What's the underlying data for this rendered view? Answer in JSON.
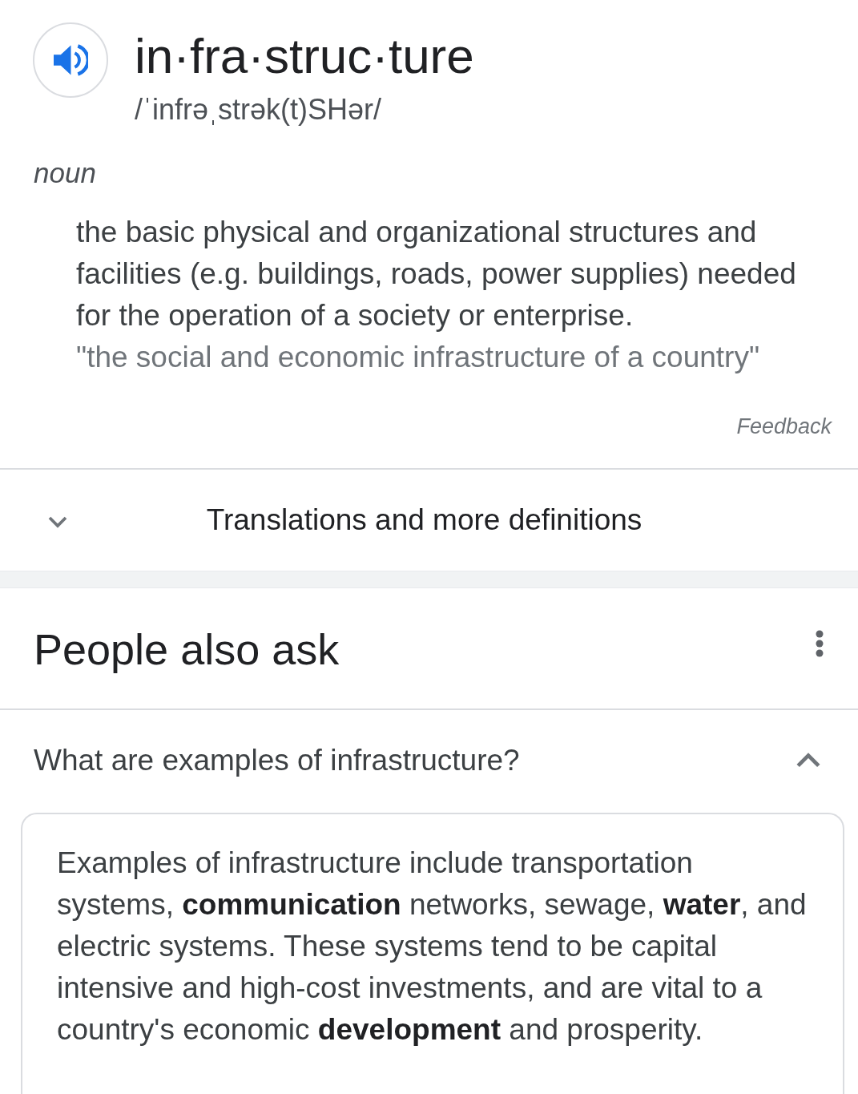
{
  "entry": {
    "headword": "in·fra·struc·ture",
    "pronunciation": "/ˈinfrəˌstrək(t)SHər/",
    "part_of_speech": "noun",
    "definition": "the basic physical and organizational structures and facilities (e.g. buildings, roads, power supplies) needed for the operation of a society or enterprise.",
    "example": "\"the social and economic infrastructure of a country\"",
    "feedback": "Feedback"
  },
  "translations": {
    "label": "Translations and more definitions",
    "expanded": false
  },
  "people_also_ask": {
    "title": "People also ask",
    "questions": [
      {
        "question": "What are examples of infrastructure?",
        "expanded": true,
        "answer": "Examples of infrastructure include transportation systems, **communication** networks, sewage, **water**, and electric systems. These systems tend to be capital intensive and high-cost investments, and are vital to a country's economic **development** and prosperity."
      }
    ]
  }
}
